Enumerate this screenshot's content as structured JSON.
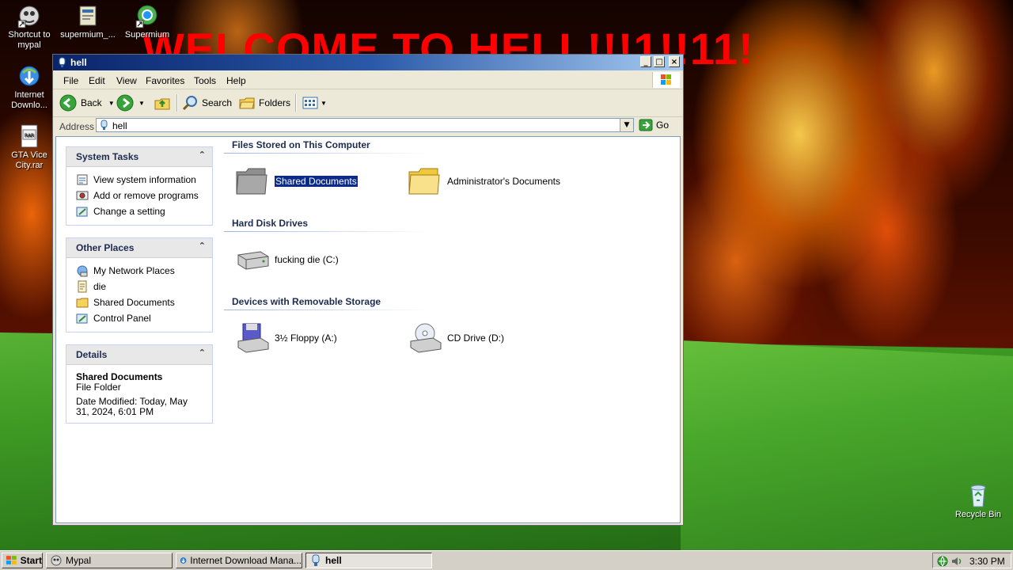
{
  "desktop": {
    "banner": "WELCOME TO HELL!!!1!!11!",
    "icons": [
      {
        "label": "Shortcut to mypal",
        "icon": "mypal-icon"
      },
      {
        "label": "supermium_...",
        "icon": "installer-icon"
      },
      {
        "label": "Supermium",
        "icon": "supermium-icon"
      },
      {
        "label": "Internet Downlo...",
        "icon": "idm-icon"
      },
      {
        "label": "GTA Vice City.rar",
        "icon": "rar-file-icon"
      },
      {
        "label": "Recycle Bin",
        "icon": "recycle-bin-icon"
      }
    ]
  },
  "window": {
    "title": "hell",
    "menu": [
      "File",
      "Edit",
      "View",
      "Favorites",
      "Tools",
      "Help"
    ],
    "toolbar": {
      "back": "Back",
      "search": "Search",
      "folders": "Folders"
    },
    "address": {
      "label": "Address",
      "value": "hell",
      "go": "Go"
    },
    "task_pane": {
      "system_tasks": {
        "title": "System Tasks",
        "items": [
          "View system information",
          "Add or remove programs",
          "Change a setting"
        ]
      },
      "other_places": {
        "title": "Other Places",
        "items": [
          "My Network Places",
          "die",
          "Shared Documents",
          "Control Panel"
        ]
      },
      "details": {
        "title": "Details",
        "name": "Shared Documents",
        "type": "File Folder",
        "modified": "Date Modified: Today, May 31, 2024, 6:01 PM"
      }
    },
    "groups": [
      {
        "title": "Files Stored on This Computer",
        "items": [
          "Shared Documents",
          "Administrator's Documents"
        ]
      },
      {
        "title": "Hard Disk Drives",
        "items": [
          "fucking die (C:)"
        ]
      },
      {
        "title": "Devices with Removable Storage",
        "items": [
          "3½ Floppy (A:)",
          "CD Drive (D:)"
        ]
      }
    ]
  },
  "taskbar": {
    "start": "Start",
    "tasks": [
      "Mypal",
      "Internet Download Mana...",
      "hell"
    ],
    "active_task": "hell",
    "clock": "3:30 PM"
  },
  "colors": {
    "banner": "#ff0000",
    "selection": "#0b2a8a",
    "panel_title": "#1d2b4f"
  }
}
